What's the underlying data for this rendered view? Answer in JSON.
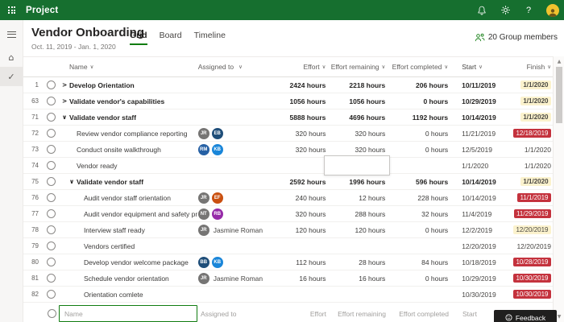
{
  "topbar": {
    "app_name": "Project"
  },
  "toolbar": {
    "title": "Vendor Onboarding",
    "date_range": "Oct. 11, 2019 - Jan. 1, 2020",
    "tabs": [
      {
        "label": "Grid",
        "active": true
      },
      {
        "label": "Board",
        "active": false
      },
      {
        "label": "Timeline",
        "active": false
      }
    ],
    "group_members_label": "20 Group members"
  },
  "grid": {
    "columns": [
      {
        "id": "name",
        "label": "Name"
      },
      {
        "id": "assign",
        "label": "Assigned to"
      },
      {
        "id": "effort",
        "label": "Effort"
      },
      {
        "id": "rem",
        "label": "Effort remaining"
      },
      {
        "id": "comp",
        "label": "Effort completed"
      },
      {
        "id": "start",
        "label": "Start"
      },
      {
        "id": "finish",
        "label": "Finish"
      }
    ],
    "rows": [
      {
        "num": 1,
        "level": 0,
        "expand": "collapsed",
        "bold": true,
        "name": "Develop Orientation",
        "assignees": [],
        "effort": "2424 hours",
        "effort_remaining": "2218 hours",
        "effort_completed": "206 hours",
        "start": "10/11/2019",
        "finish": "1/1/2020",
        "finish_status": "warning"
      },
      {
        "num": 63,
        "level": 0,
        "expand": "collapsed",
        "bold": true,
        "name": "Validate vendor's capabilities",
        "assignees": [],
        "effort": "1056 hours",
        "effort_remaining": "1056 hours",
        "effort_completed": "0 hours",
        "start": "10/29/2019",
        "finish": "1/1/2020",
        "finish_status": "warning"
      },
      {
        "num": 71,
        "level": 0,
        "expand": "expanded",
        "bold": true,
        "name": "Validate vendor staff",
        "assignees": [],
        "effort": "5888 hours",
        "effort_remaining": "4696 hours",
        "effort_completed": "1192 hours",
        "start": "10/14/2019",
        "finish": "1/1/2020",
        "finish_status": "warning"
      },
      {
        "num": 72,
        "level": 1,
        "expand": null,
        "bold": false,
        "name": "Review vendor compliance reporting",
        "assignees": [
          {
            "initials": "JR",
            "color": "#767574"
          },
          {
            "initials": "EB",
            "color": "#1f4e79"
          }
        ],
        "effort": "320 hours",
        "effort_remaining": "320 hours",
        "effort_completed": "0 hours",
        "start": "11/21/2019",
        "finish": "12/18/2019",
        "finish_status": "late"
      },
      {
        "num": 73,
        "level": 1,
        "expand": null,
        "bold": false,
        "name": "Conduct onsite walkthrough",
        "assignees": [
          {
            "initials": "RM",
            "color": "#2660a4"
          },
          {
            "initials": "KB",
            "color": "#1a86d9"
          }
        ],
        "effort": "320 hours",
        "effort_remaining": "320 hours",
        "effort_completed": "0 hours",
        "start": "12/5/2019",
        "finish": "1/1/2020",
        "finish_status": "none"
      },
      {
        "num": 74,
        "level": 1,
        "expand": null,
        "bold": false,
        "name": "Vendor ready",
        "assignees": [],
        "effort": "",
        "effort_remaining": "",
        "effort_completed": "",
        "start": "1/1/2020",
        "finish": "1/1/2020",
        "finish_status": "none",
        "editing": "effort_remaining"
      },
      {
        "num": 75,
        "level": 1,
        "expand": "expanded",
        "bold": true,
        "name": "Validate vendor staff",
        "assignees": [],
        "effort": "2592 hours",
        "effort_remaining": "1996 hours",
        "effort_completed": "596 hours",
        "start": "10/14/2019",
        "finish": "1/1/2020",
        "finish_status": "warning"
      },
      {
        "num": 76,
        "level": 2,
        "expand": null,
        "bold": false,
        "name": "Audit vendor staff orientation",
        "assignees": [
          {
            "initials": "JR",
            "color": "#767574"
          },
          {
            "initials": "EF",
            "color": "#ca5010"
          }
        ],
        "effort": "240 hours",
        "effort_remaining": "12 hours",
        "effort_completed": "228 hours",
        "start": "10/14/2019",
        "finish": "11/1/2019",
        "finish_status": "late"
      },
      {
        "num": 77,
        "level": 2,
        "expand": null,
        "bold": false,
        "name": "Audit vendor equipment and safety proce...",
        "assignees": [
          {
            "initials": "NT",
            "color": "#767574"
          },
          {
            "initials": "RB",
            "color": "#962aa8"
          }
        ],
        "effort": "320 hours",
        "effort_remaining": "288 hours",
        "effort_completed": "32 hours",
        "start": "11/4/2019",
        "finish": "11/29/2019",
        "finish_status": "late"
      },
      {
        "num": 78,
        "level": 2,
        "expand": null,
        "bold": false,
        "name": "Interview staff ready",
        "assignees": [
          {
            "initials": "JR",
            "color": "#767574",
            "label": "Jasmine Roman"
          }
        ],
        "effort": "120 hours",
        "effort_remaining": "120 hours",
        "effort_completed": "0 hours",
        "start": "12/2/2019",
        "finish": "12/20/2019",
        "finish_status": "warning"
      },
      {
        "num": 79,
        "level": 2,
        "expand": null,
        "bold": false,
        "name": "Vendors certified",
        "assignees": [],
        "effort": "",
        "effort_remaining": "",
        "effort_completed": "",
        "start": "12/20/2019",
        "finish": "12/20/2019",
        "finish_status": "none"
      },
      {
        "num": 80,
        "level": 2,
        "expand": null,
        "bold": false,
        "name": "Develop vendor welcome package",
        "assignees": [
          {
            "initials": "BB",
            "color": "#1f4e79"
          },
          {
            "initials": "KB",
            "color": "#1a86d9"
          }
        ],
        "effort": "112 hours",
        "effort_remaining": "28 hours",
        "effort_completed": "84 hours",
        "start": "10/18/2019",
        "finish": "10/28/2019",
        "finish_status": "late"
      },
      {
        "num": 81,
        "level": 2,
        "expand": null,
        "bold": false,
        "name": "Schedule vendor orientation",
        "assignees": [
          {
            "initials": "JR",
            "color": "#767574",
            "label": "Jasmine Roman"
          }
        ],
        "effort": "16 hours",
        "effort_remaining": "16 hours",
        "effort_completed": "0 hours",
        "start": "10/29/2019",
        "finish": "10/30/2019",
        "finish_status": "late"
      },
      {
        "num": 82,
        "level": 2,
        "expand": null,
        "bold": false,
        "name": "Orientation comlete",
        "assignees": [],
        "effort": "",
        "effort_remaining": "",
        "effort_completed": "",
        "start": "10/30/2019",
        "finish": "10/30/2019",
        "finish_status": "late"
      }
    ],
    "new_row": {
      "name": "Name",
      "assigned_to": "Assigned to",
      "effort": "Effort",
      "effort_remaining": "Effort remaining",
      "effort_completed": "Effort completed",
      "start": "Start"
    }
  },
  "feedback": {
    "label": "Feedback"
  },
  "colors": {
    "topbar_green": "#166f2f",
    "accent_green": "#107c10",
    "warning_badge_bg": "#fbf2cd",
    "late_badge_bg": "#c4323d"
  }
}
